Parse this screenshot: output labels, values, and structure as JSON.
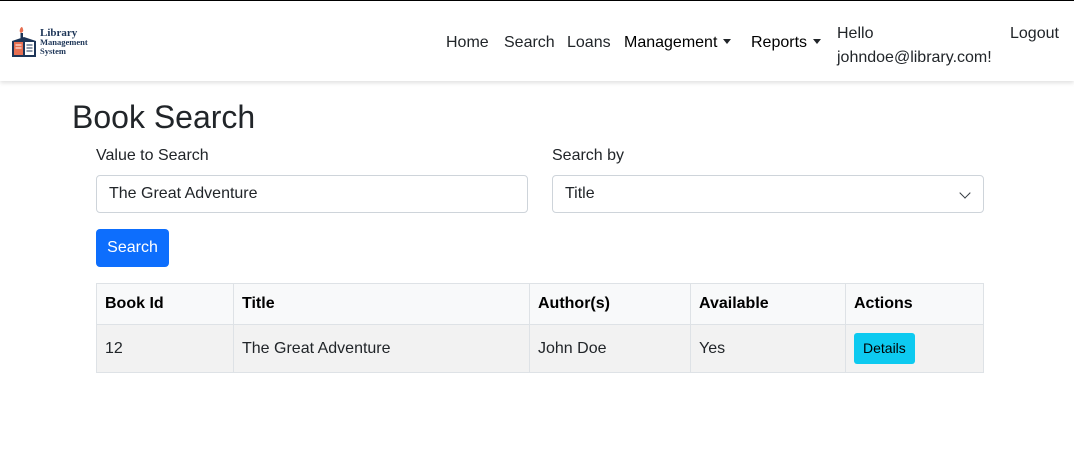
{
  "brand": {
    "line1": "Library",
    "line2": "Management",
    "line3": "System"
  },
  "nav": {
    "home": "Home",
    "search": "Search",
    "loans": "Loans",
    "management": "Management",
    "reports": "Reports",
    "hello_line1": "Hello",
    "hello_line2": "johndoe@library.com!",
    "logout": "Logout"
  },
  "page": {
    "title": "Book Search"
  },
  "form": {
    "value_label": "Value to Search",
    "value": "The Great Adventure",
    "search_by_label": "Search by",
    "search_by_selected": "Title",
    "search_button": "Search"
  },
  "table": {
    "columns": [
      "Book Id",
      "Title",
      "Author(s)",
      "Available",
      "Actions"
    ],
    "rows": [
      {
        "book_id": "12",
        "title": "The Great Adventure",
        "authors": "John Doe",
        "available": "Yes",
        "action": "Details"
      }
    ]
  },
  "colors": {
    "primary": "#0d6efd",
    "info": "#0dcaf0",
    "brand": "#1d3557",
    "brand_accent": "#e76f51"
  }
}
